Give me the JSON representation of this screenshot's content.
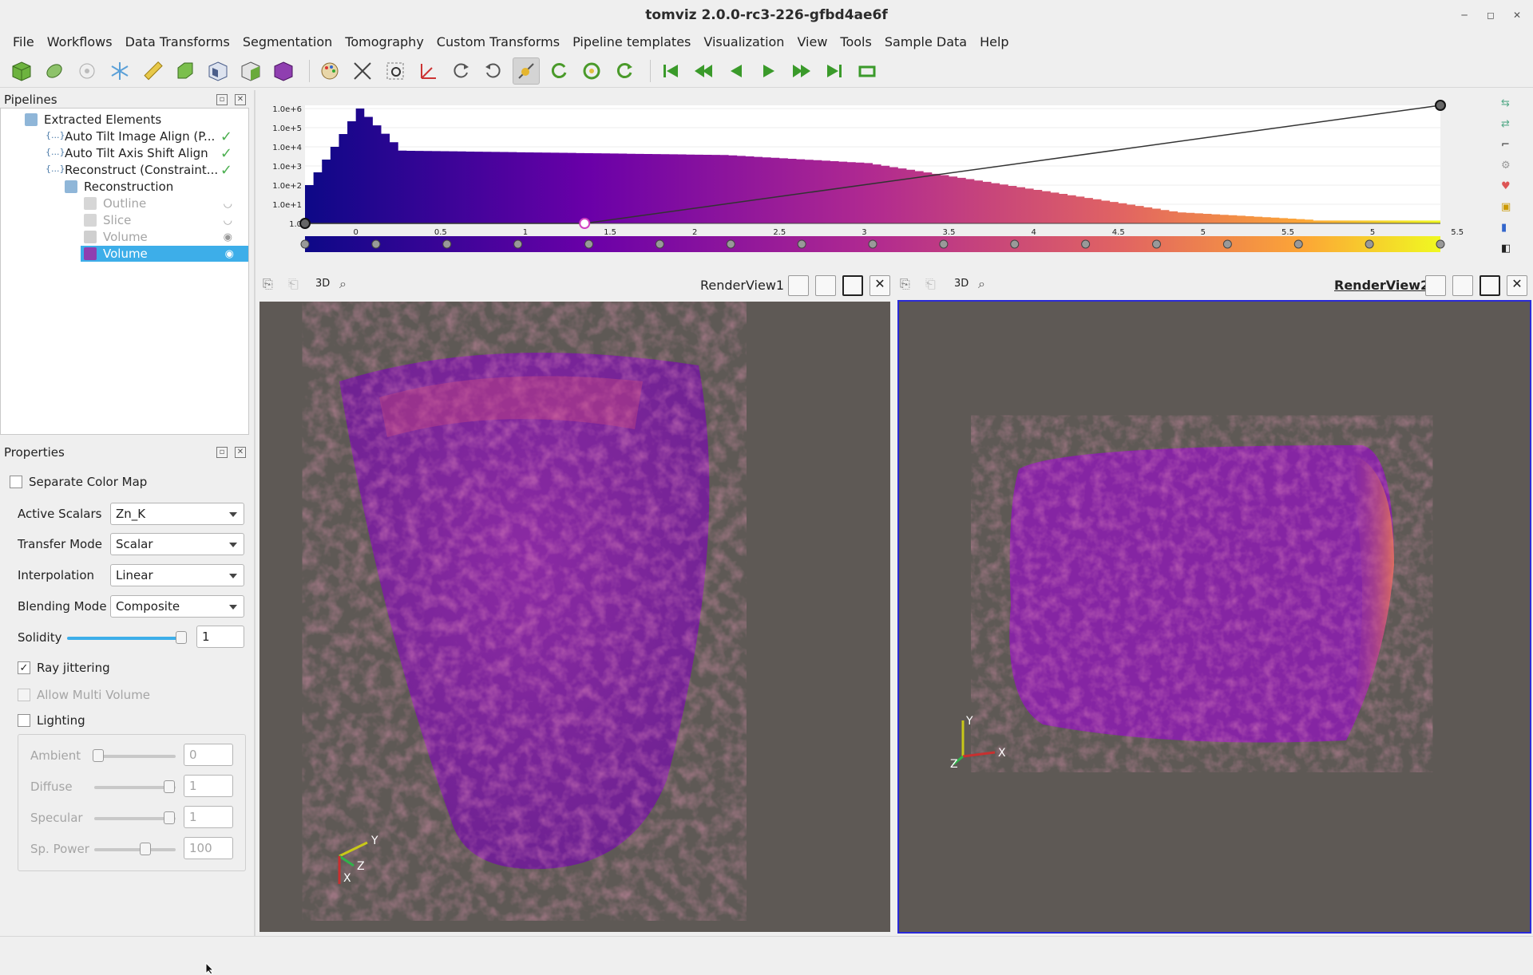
{
  "window": {
    "title": "tomviz 2.0.0-rc3-226-gfbd4ae6f"
  },
  "menu": [
    "File",
    "Workflows",
    "Data Transforms",
    "Segmentation",
    "Tomography",
    "Custom Transforms",
    "Pipeline templates",
    "Visualization",
    "View",
    "Tools",
    "Sample Data",
    "Help"
  ],
  "pipelines": {
    "header": "Pipelines",
    "items": [
      {
        "label": "Extracted Elements",
        "kind": "data",
        "state": "root"
      },
      {
        "label": "Auto Tilt Image Align (P...",
        "kind": "op",
        "state": "done"
      },
      {
        "label": "Auto Tilt Axis Shift Align",
        "kind": "op",
        "state": "done"
      },
      {
        "label": "Reconstruct (Constraint...",
        "kind": "op",
        "state": "done"
      },
      {
        "label": "Reconstruction",
        "kind": "data",
        "state": "child"
      },
      {
        "label": "Outline",
        "kind": "module",
        "state": "hidden"
      },
      {
        "label": "Slice",
        "kind": "module",
        "state": "hidden"
      },
      {
        "label": "Volume",
        "kind": "module",
        "state": "visible-dim"
      },
      {
        "label": "Volume",
        "kind": "module",
        "state": "selected"
      }
    ]
  },
  "properties": {
    "header": "Properties",
    "separate_color_map": "Separate Color Map",
    "active_scalars_label": "Active Scalars",
    "active_scalars": "Zn_K",
    "transfer_mode_label": "Transfer Mode",
    "transfer_mode": "Scalar",
    "interpolation_label": "Interpolation",
    "interpolation": "Linear",
    "blending_label": "Blending Mode",
    "blending": "Composite",
    "solidity_label": "Solidity",
    "solidity": "1",
    "ray_jittering": "Ray jittering",
    "allow_multi": "Allow Multi Volume",
    "lighting": "Lighting",
    "ambient_label": "Ambient",
    "ambient": "0",
    "diffuse_label": "Diffuse",
    "diffuse": "1",
    "specular_label": "Specular",
    "specular": "1",
    "sppower_label": "Sp. Power",
    "sppower": "100",
    "checks": {
      "separate_color_map": false,
      "ray_jittering": true,
      "allow_multi": false,
      "lighting": false
    }
  },
  "histogram": {
    "y_ticks": [
      "1.0e+6",
      "1.0e+5",
      "1.0e+4",
      "1.0e+3",
      "1.0e+2",
      "1.0e+1",
      "1.0"
    ],
    "x_ticks": [
      "0",
      "0.5",
      "1",
      "1.5",
      "2",
      "2.5",
      "3",
      "3.5",
      "4",
      "4.5",
      "5",
      "5.5",
      "5",
      "5.5"
    ],
    "opacity_points": [
      [
        -0.3,
        0
      ],
      [
        1.35,
        0
      ],
      [
        6.4,
        1
      ]
    ]
  },
  "views": {
    "rv1": {
      "label": "RenderView1",
      "mode": "3D"
    },
    "rv2": {
      "label": "RenderView2",
      "mode": "3D"
    },
    "axes": {
      "x": "X",
      "y": "Y",
      "z": "Z"
    }
  },
  "colors": {
    "accent": "#3daee9",
    "selection": "#3daee9",
    "active_view_border": "#2a2ad8",
    "check_green": "#4caf50"
  }
}
